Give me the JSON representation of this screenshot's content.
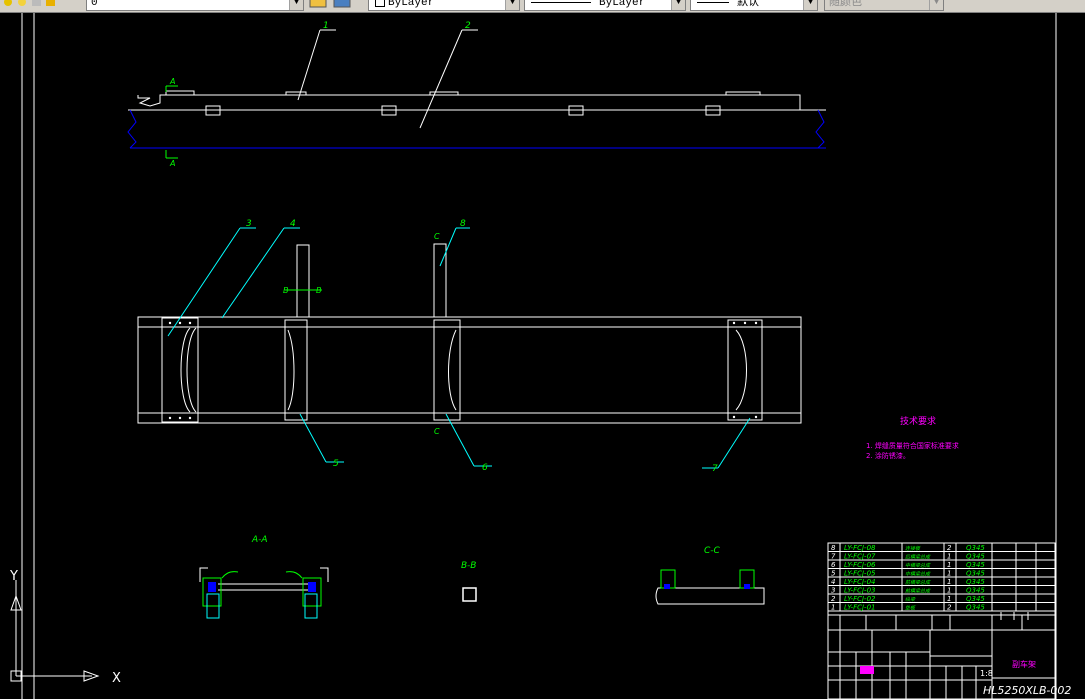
{
  "toolbar": {
    "layer_value": "0",
    "color_value": "ByLayer",
    "linetype_value": "ByLayer",
    "lineweight_value": "默认",
    "plotstyle_value": "随颜色"
  },
  "drawing": {
    "callouts": [
      "1",
      "2",
      "3",
      "4",
      "5",
      "6",
      "7",
      "8"
    ],
    "section_labels": {
      "aa": "A-A",
      "bb": "B-B",
      "cc": "C-C"
    },
    "view_marks": {
      "a_top": "A",
      "a_bottom": "A",
      "b": "B",
      "c": "C"
    },
    "tech_title": "技术要求",
    "tech_notes": [
      "1. 焊缝质量符合国家标准要求",
      "2. 涂防锈漆。"
    ],
    "ucs": {
      "x": "X",
      "y": "Y"
    },
    "drawing_number": "HL5250XLB-002",
    "scale": "1:8",
    "title_name": "副车架",
    "bom": [
      {
        "seq": "8",
        "code": "LY-FCJ-08",
        "name": "连接板",
        "qty": "2",
        "material": "Q345"
      },
      {
        "seq": "7",
        "code": "LY-FCJ-07",
        "name": "后横梁总成",
        "qty": "1",
        "material": "Q345"
      },
      {
        "seq": "6",
        "code": "LY-FCJ-06",
        "name": "中横梁总成",
        "qty": "1",
        "material": "Q345"
      },
      {
        "seq": "5",
        "code": "LY-FCJ-05",
        "name": "中横梁总成",
        "qty": "1",
        "material": "Q345"
      },
      {
        "seq": "4",
        "code": "LY-FCJ-04",
        "name": "前横梁总成",
        "qty": "1",
        "material": "Q345"
      },
      {
        "seq": "3",
        "code": "LY-FCJ-03",
        "name": "前横梁总成",
        "qty": "1",
        "material": "Q345"
      },
      {
        "seq": "2",
        "code": "LY-FCJ-02",
        "name": "纵梁",
        "qty": "1",
        "material": "Q345"
      },
      {
        "seq": "1",
        "code": "LY-FCJ-01",
        "name": "垫板",
        "qty": "2",
        "material": "Q345"
      }
    ]
  }
}
